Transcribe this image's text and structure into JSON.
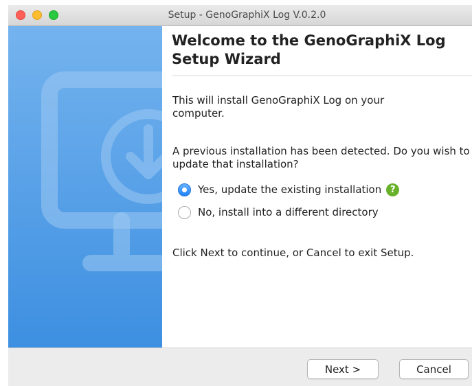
{
  "window": {
    "title": "Setup - GenoGraphiX Log V.0.2.0"
  },
  "sidebar": {
    "illustration_icon": "monitor-download-icon"
  },
  "content": {
    "heading": "Welcome to the GenoGraphiX Log Setup Wizard",
    "intro_text": "This will install GenoGraphiX Log on your computer.",
    "detected_text": "A previous installation has been detected. Do you wish to update that installation?",
    "options": [
      {
        "label": "Yes, update the existing installation",
        "selected": true,
        "help_icon": "question-circle-icon"
      },
      {
        "label": "No, install into a different directory",
        "selected": false
      }
    ],
    "continue_text": "Click Next to continue, or Cancel to exit Setup."
  },
  "footer": {
    "next_label": "Next >",
    "cancel_label": "Cancel"
  },
  "colors": {
    "sidebar_top": "#74b3ee",
    "sidebar_bottom": "#3d8fe1",
    "radio_selected": "#2a88f5",
    "help_icon": "#68b12a"
  }
}
